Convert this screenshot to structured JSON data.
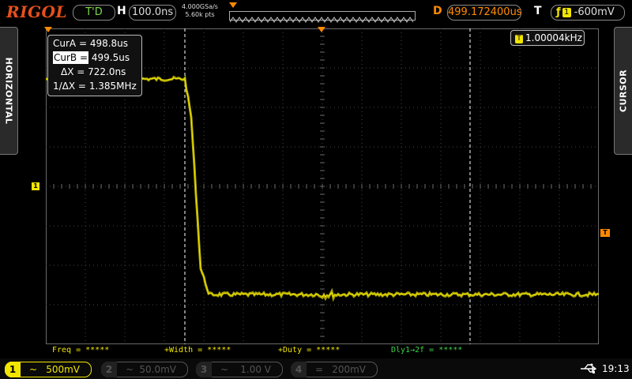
{
  "header": {
    "brand": "RIGOL",
    "trigger_status": "T'D",
    "h_label": "H",
    "timebase": "100.0ns",
    "sample_rate": "4.000GSa/s",
    "memory_depth": "5.60k pts",
    "d_label": "D",
    "delay": "499.172400us",
    "t_label": "T",
    "trigger_source": "1",
    "trigger_level": "-600mV"
  },
  "side_tabs": {
    "left": "HORIZONTAL",
    "right": "CURSOR"
  },
  "cursor_readout": {
    "a_label": "CurA =",
    "a_value": "498.8us",
    "b_label": "CurB =",
    "b_value": "499.5us",
    "dx_label": "ΔX =",
    "dx_value": "722.0ns",
    "inv_label": "1/ΔX =",
    "inv_value": "1.385MHz"
  },
  "freq_counter": {
    "source": "T",
    "value": "1.00004kHz"
  },
  "markers": {
    "ch1": "1",
    "trigger": "T"
  },
  "measurements": {
    "freq": "Freq = *****",
    "width": "+Width = *****",
    "duty": "+Duty = *****",
    "delay": "Dly1→2f = *****"
  },
  "channels": [
    {
      "num": "1",
      "coupling": "~",
      "scale": "500mV",
      "active": true
    },
    {
      "num": "2",
      "coupling": "~",
      "scale": "50.0mV",
      "active": false
    },
    {
      "num": "3",
      "coupling": "~",
      "scale": "1.00 V",
      "active": false
    },
    {
      "num": "4",
      "coupling": "=",
      "scale": "200mV",
      "active": false
    }
  ],
  "status": {
    "time": "19:13"
  },
  "colors": {
    "ch1": "#f2e600",
    "accent": "#ff8a00",
    "trig_ok": "#7ed84a",
    "grid": "#5a5a5a"
  }
}
